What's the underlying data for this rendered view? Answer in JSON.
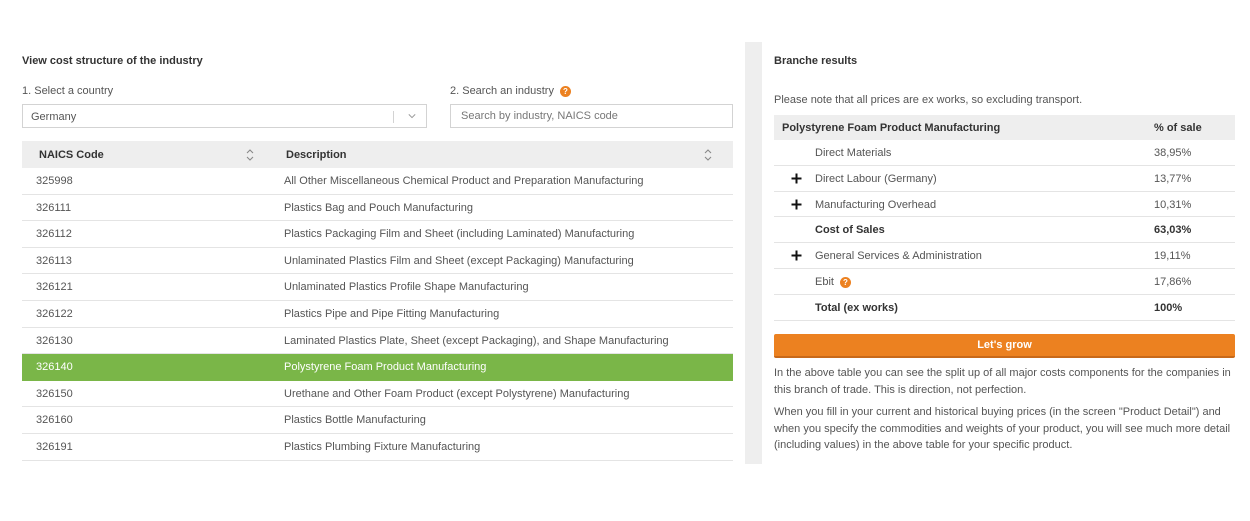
{
  "left": {
    "title": "View cost structure of the industry",
    "country_label": "1. Select a country",
    "country_value": "Germany",
    "industry_label": "2. Search an industry",
    "industry_help_icon": "question-circle-icon",
    "search_placeholder": "Search by industry, NAICS code",
    "columns": [
      "NAICS Code",
      "Description"
    ],
    "rows": [
      {
        "code": "325998",
        "desc": "All Other Miscellaneous Chemical Product and Preparation Manufacturing"
      },
      {
        "code": "326111",
        "desc": "Plastics Bag and Pouch Manufacturing"
      },
      {
        "code": "326112",
        "desc": "Plastics Packaging Film and Sheet (including Laminated) Manufacturing"
      },
      {
        "code": "326113",
        "desc": "Unlaminated Plastics Film and Sheet (except Packaging) Manufacturing"
      },
      {
        "code": "326121",
        "desc": "Unlaminated Plastics Profile Shape Manufacturing"
      },
      {
        "code": "326122",
        "desc": "Plastics Pipe and Pipe Fitting Manufacturing"
      },
      {
        "code": "326130",
        "desc": "Laminated Plastics Plate, Sheet (except Packaging), and Shape Manufacturing"
      },
      {
        "code": "326140",
        "desc": "Polystyrene Foam Product Manufacturing"
      },
      {
        "code": "326150",
        "desc": "Urethane and Other Foam Product (except Polystyrene) Manufacturing"
      },
      {
        "code": "326160",
        "desc": "Plastics Bottle Manufacturing"
      },
      {
        "code": "326191",
        "desc": "Plastics Plumbing Fixture Manufacturing"
      }
    ],
    "selected_code": "326140"
  },
  "right": {
    "title": "Branche results",
    "note": "Please note that all prices are ex works, so excluding transport.",
    "table_header": {
      "name": "Polystyrene Foam Product Manufacturing",
      "pct": "% of sale"
    },
    "rows": [
      {
        "label": "Direct Materials",
        "value": "38,95%",
        "plus": false,
        "bold": false,
        "help": false
      },
      {
        "label": "Direct Labour (Germany)",
        "value": "13,77%",
        "plus": true,
        "bold": false,
        "help": false
      },
      {
        "label": "Manufacturing Overhead",
        "value": "10,31%",
        "plus": true,
        "bold": false,
        "help": false
      },
      {
        "label": "Cost of Sales",
        "value": "63,03%",
        "plus": false,
        "bold": true,
        "help": false
      },
      {
        "label": "General Services & Administration",
        "value": "19,11%",
        "plus": true,
        "bold": false,
        "help": false
      },
      {
        "label": "Ebit",
        "value": "17,86%",
        "plus": false,
        "bold": false,
        "help": true
      },
      {
        "label": "Total (ex works)",
        "value": "100%",
        "plus": false,
        "bold": true,
        "help": false
      }
    ],
    "cta_label": "Let's grow",
    "para1": "In the above table you can see the split up of all major costs components for the companies in this branch of trade. This is direction, not perfection.",
    "para2": "When you fill in your current and historical buying prices (in the screen \"Product Detail\") and when you specify the commodities and weights of your product, you will see much more detail (including values) in the above table for your specific product."
  },
  "colors": {
    "accent_orange": "#ec8120",
    "selected_green": "#7ab648",
    "header_gray": "#eeeeee"
  }
}
